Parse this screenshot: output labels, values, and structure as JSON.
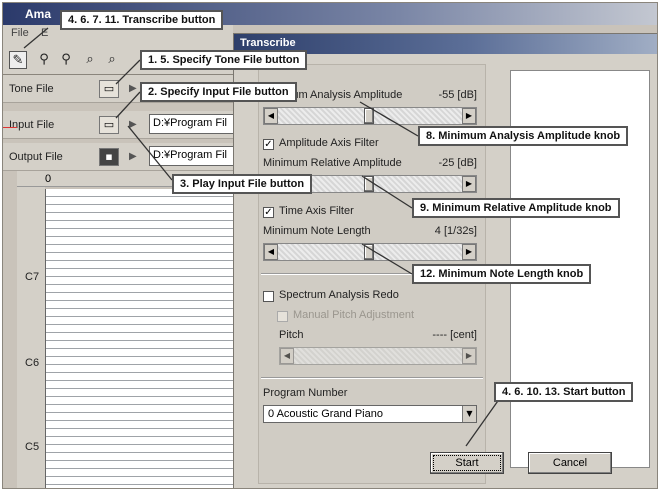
{
  "main_window": {
    "title": "Ama",
    "menu": [
      "File",
      "E"
    ],
    "rows": [
      {
        "label": "Tone File",
        "path": ""
      },
      {
        "label": "Input File",
        "path": "D:¥Program Fil"
      },
      {
        "label": "Output File",
        "path": "D:¥Program Fil"
      }
    ],
    "ruler_start": "0",
    "octaves": [
      "C7",
      "C6",
      "C5"
    ]
  },
  "dialog": {
    "title": "Transcribe",
    "min_analysis_amplitude": {
      "label": "Minimum Analysis Amplitude",
      "value": "-55 [dB]",
      "level": 0.5
    },
    "amplitude_axis_filter": {
      "label": "Amplitude Axis Filter",
      "checked": true
    },
    "min_relative_amplitude": {
      "label": "Minimum Relative Amplitude",
      "value": "-25 [dB]",
      "level": 0.5
    },
    "time_axis_filter": {
      "label": "Time Axis Filter",
      "checked": true
    },
    "min_note_length": {
      "label": "Minimum Note Length",
      "value": "4 [1/32s]",
      "level": 0.5
    },
    "spectrum_redo": {
      "label": "Spectrum Analysis Redo",
      "checked": false
    },
    "manual_pitch": {
      "label": "Manual Pitch Adjustment",
      "checked": false
    },
    "pitch": {
      "label": "Pitch",
      "value": "---- [cent]"
    },
    "program_number": {
      "label": "Program Number",
      "selected": "0 Acoustic Grand Piano"
    },
    "start_button": "Start",
    "cancel_button": "Cancel"
  },
  "callouts": {
    "transcribe": "4. 6. 7. 11. Transcribe button",
    "tone": "1. 5. Specify Tone File button",
    "input": "2. Specify Input File button",
    "play": "3. Play Input File button",
    "min_amp": "8. Minimum Analysis Amplitude knob",
    "min_rel": "9. Minimum Relative Amplitude knob",
    "note_len": "12. Minimum Note Length knob",
    "start": "4. 6. 10. 13. Start button"
  }
}
